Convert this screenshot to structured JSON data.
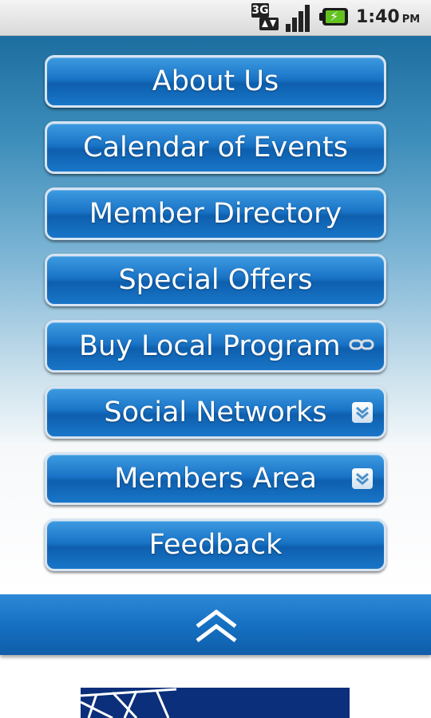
{
  "status_bar": {
    "network": "3G",
    "time": "1:40",
    "ampm": "PM",
    "icons": [
      "network-3g-icon",
      "signal-strength-icon",
      "battery-charging-icon"
    ]
  },
  "menu": {
    "items": [
      {
        "label": "About Us",
        "icon": null
      },
      {
        "label": "Calendar of Events",
        "icon": null
      },
      {
        "label": "Member Directory",
        "icon": null
      },
      {
        "label": "Special Offers",
        "icon": null
      },
      {
        "label": "Buy Local Program",
        "icon": "link-icon"
      },
      {
        "label": "Social Networks",
        "icon": "chevron-down-icon"
      },
      {
        "label": "Members Area",
        "icon": "chevron-down-icon"
      },
      {
        "label": "Feedback",
        "icon": null
      }
    ]
  },
  "collapse_bar": {
    "icon": "double-chevron-up-icon"
  },
  "colors": {
    "button_blue": "#1a74c7",
    "button_border": "#d6e4f2",
    "bar_blue": "#1670c2",
    "banner_navy": "#0b2f7a"
  }
}
